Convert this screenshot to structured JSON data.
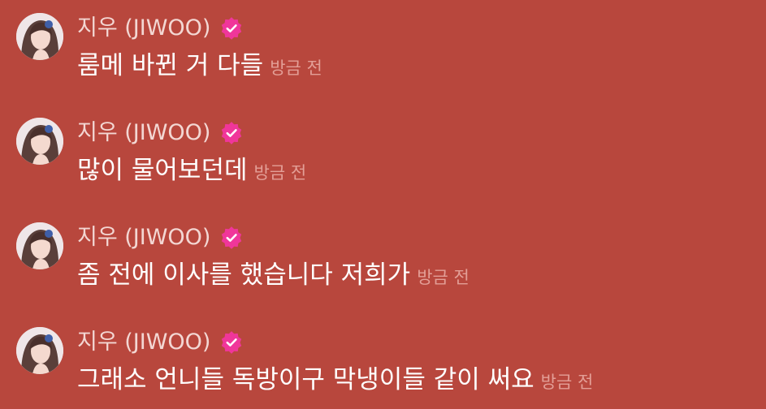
{
  "colors": {
    "background": "#b8473d",
    "name_text": "#f3d7d3",
    "message_text": "#ffffff",
    "timestamp_text": "#e39f97",
    "verified_badge": "#f0369a"
  },
  "messages": [
    {
      "sender": "지우 (JIWOO)",
      "avatar_icon": "profile-photo-icon",
      "badge_icon": "verified-badge-icon",
      "text": "룸메 바뀐 거 다들",
      "time": "방금 전"
    },
    {
      "sender": "지우 (JIWOO)",
      "avatar_icon": "profile-photo-icon",
      "badge_icon": "verified-badge-icon",
      "text": "많이 물어보던데",
      "time": "방금 전"
    },
    {
      "sender": "지우 (JIWOO)",
      "avatar_icon": "profile-photo-icon",
      "badge_icon": "verified-badge-icon",
      "text": "좀 전에 이사를 했습니다 저희가",
      "time": "방금 전"
    },
    {
      "sender": "지우 (JIWOO)",
      "avatar_icon": "profile-photo-icon",
      "badge_icon": "verified-badge-icon",
      "text": "그래소 언니들 독방이구 막냉이들 같이 써요",
      "time": "방금 전"
    }
  ]
}
